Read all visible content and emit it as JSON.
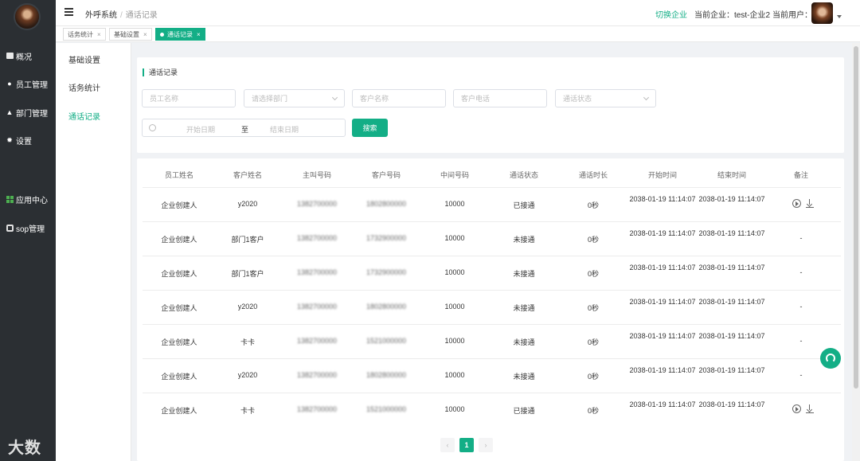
{
  "sidebar": {
    "items": [
      {
        "label": "概况",
        "icon": "overview-icon"
      },
      {
        "label": "员工管理",
        "icon": "user-icon"
      },
      {
        "label": "部门管理",
        "icon": "org-icon"
      },
      {
        "label": "设置",
        "icon": "gear-icon"
      },
      {
        "label": "应用中心",
        "icon": "apps-icon"
      },
      {
        "label": "sop管理",
        "icon": "cube-icon"
      }
    ],
    "watermark": "大数跨境"
  },
  "header": {
    "breadcrumb": [
      "外呼系统",
      "通话记录"
    ],
    "switch_label": "切换企业",
    "company_label": "当前企业：test-企业2",
    "user_label": "当前用户："
  },
  "tabs": [
    {
      "label": "话务统计",
      "active": false
    },
    {
      "label": "基础设置",
      "active": false
    },
    {
      "label": "通话记录",
      "active": true
    }
  ],
  "submenu": [
    "基础设置",
    "话务统计",
    "通话记录"
  ],
  "filters": {
    "title": "通话记录",
    "employee_placeholder": "员工名称",
    "dept_placeholder": "请选择部门",
    "customer_placeholder": "客户名称",
    "phone_placeholder": "客户电话",
    "status_placeholder": "通话状态",
    "start_placeholder": "开始日期",
    "range_sep": "至",
    "end_placeholder": "结束日期",
    "search_label": "搜索"
  },
  "table": {
    "columns": [
      "员工姓名",
      "客户姓名",
      "主叫号码",
      "客户号码",
      "中间号码",
      "通话状态",
      "通话时长",
      "开始时间",
      "结束时间",
      "备注"
    ],
    "rows": [
      {
        "employee": "企业创建人",
        "customer": "y2020",
        "caller": "1382700000",
        "cust_phone": "1802800000",
        "middle": "10000",
        "status": "已接通",
        "duration": "0秒",
        "start": "2038-01-19 11:14:07",
        "end": "2038-01-19 11:14:07",
        "note": "",
        "has_actions": true
      },
      {
        "employee": "企业创建人",
        "customer": "部门1客户",
        "caller": "1382700000",
        "cust_phone": "1732900000",
        "middle": "10000",
        "status": "未接通",
        "duration": "0秒",
        "start": "2038-01-19 11:14:07",
        "end": "2038-01-19 11:14:07",
        "note": "-",
        "has_actions": false
      },
      {
        "employee": "企业创建人",
        "customer": "部门1客户",
        "caller": "1382700000",
        "cust_phone": "1732900000",
        "middle": "10000",
        "status": "未接通",
        "duration": "0秒",
        "start": "2038-01-19 11:14:07",
        "end": "2038-01-19 11:14:07",
        "note": "-",
        "has_actions": false
      },
      {
        "employee": "企业创建人",
        "customer": "y2020",
        "caller": "1382700000",
        "cust_phone": "1802800000",
        "middle": "10000",
        "status": "未接通",
        "duration": "0秒",
        "start": "2038-01-19 11:14:07",
        "end": "2038-01-19 11:14:07",
        "note": "-",
        "has_actions": false
      },
      {
        "employee": "企业创建人",
        "customer": "卡卡",
        "caller": "1382700000",
        "cust_phone": "1521000000",
        "middle": "10000",
        "status": "未接通",
        "duration": "0秒",
        "start": "2038-01-19 11:14:07",
        "end": "2038-01-19 11:14:07",
        "note": "-",
        "has_actions": false
      },
      {
        "employee": "企业创建人",
        "customer": "y2020",
        "caller": "1382700000",
        "cust_phone": "1802800000",
        "middle": "10000",
        "status": "未接通",
        "duration": "0秒",
        "start": "2038-01-19 11:14:07",
        "end": "2038-01-19 11:14:07",
        "note": "-",
        "has_actions": false
      },
      {
        "employee": "企业创建人",
        "customer": "卡卡",
        "caller": "1382700000",
        "cust_phone": "1521000000",
        "middle": "10000",
        "status": "已接通",
        "duration": "0秒",
        "start": "2038-01-19 11:14:07",
        "end": "2038-01-19 11:14:07",
        "note": "",
        "has_actions": true
      }
    ]
  },
  "pagination": {
    "prev": "‹",
    "current": "1",
    "next": "›"
  },
  "colors": {
    "accent": "#13ae86",
    "sidebar_bg": "#2b2f33"
  }
}
